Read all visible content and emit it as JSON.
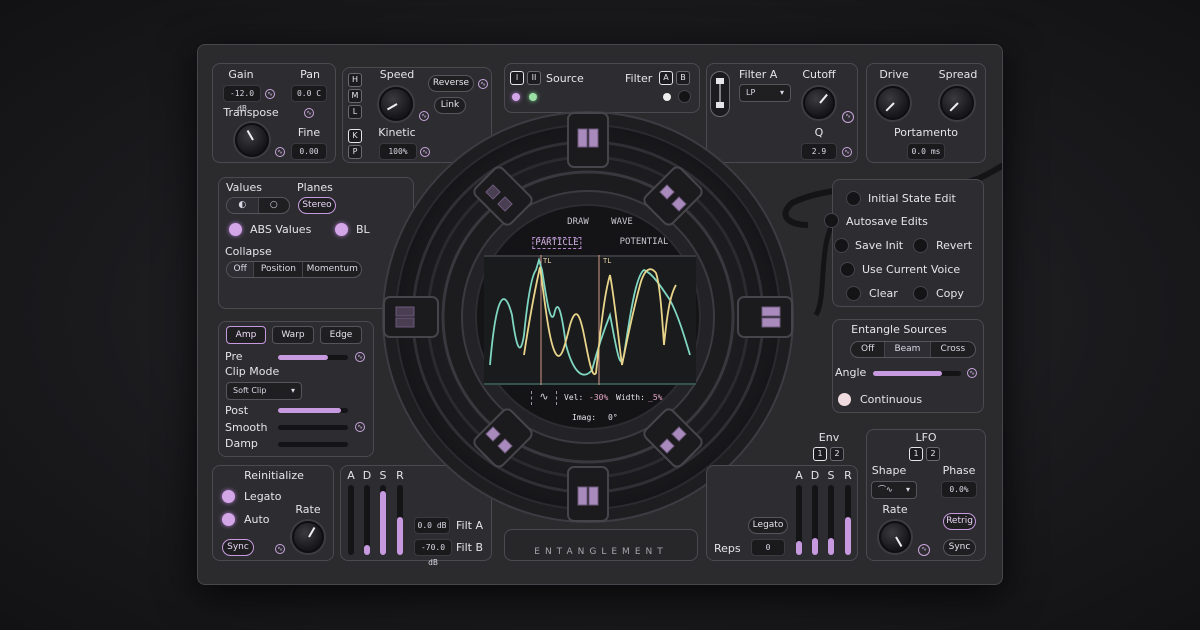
{
  "top_left": {
    "gain_label": "Gain",
    "gain_value": "-12.0 dB",
    "pan_label": "Pan",
    "pan_value": "0.0 C",
    "transpose_label": "Transpose",
    "fine_label": "Fine",
    "fine_value": "0.00"
  },
  "mode_buttons": [
    "H",
    "M",
    "L",
    "K",
    "P"
  ],
  "speed": {
    "label": "Speed",
    "kinetic_label": "Kinetic",
    "kinetic_value": "100%",
    "reverse_label": "Reverse",
    "link_label": "Link"
  },
  "source": {
    "roman": [
      "I",
      "II"
    ],
    "label": "Source",
    "filter_label": "Filter",
    "filter_options": [
      "A",
      "B"
    ]
  },
  "filter_a": {
    "label": "Filter A",
    "type_value": "LP",
    "cutoff_label": "Cutoff",
    "q_label": "Q",
    "q_value": "2.9"
  },
  "drive_spread": {
    "drive_label": "Drive",
    "spread_label": "Spread",
    "portamento_label": "Portamento",
    "portamento_value": "0.0 ms"
  },
  "values_panel": {
    "values_label": "Values",
    "planes_label": "Planes",
    "planes_value": "Stereo",
    "abs_label": "ABS Values",
    "bl_label": "BL",
    "collapse_label": "Collapse",
    "collapse_options": [
      "Off",
      "Position",
      "Momentum"
    ]
  },
  "amp_panel": {
    "tabs": [
      "Amp",
      "Warp",
      "Edge"
    ],
    "pre_label": "Pre",
    "pre_level": 0.72,
    "clip_mode_label": "Clip Mode",
    "clip_mode_value": "Soft Clip",
    "post_label": "Post",
    "post_level": 0.9,
    "smooth_label": "Smooth",
    "damp_label": "Damp"
  },
  "reinit": {
    "title": "Reinitialize",
    "legato_label": "Legato",
    "auto_label": "Auto",
    "sync_label": "Sync",
    "rate_label": "Rate"
  },
  "adsr_left": {
    "letters": [
      "A",
      "D",
      "S",
      "R"
    ],
    "levels": [
      0.0,
      0.15,
      0.92,
      0.55
    ],
    "filt_a_label": "Filt A",
    "filt_a_value": "0.0 dB",
    "filt_b_label": "Filt B",
    "filt_b_value": "-70.0 dB"
  },
  "brand": "ENTANGLEMENT",
  "display": {
    "tabs_top": [
      "DRAW",
      "WAVE"
    ],
    "tabs_bottom": [
      "PARTICLE",
      "POTENTIAL"
    ],
    "marker_label": "TL",
    "vel_label": "Vel:",
    "vel_value": "-30%",
    "width_label": "Width:",
    "width_value": "_5%",
    "imag_label": "Imag:",
    "imag_value": "0°"
  },
  "state_panel": {
    "initial_state": "Initial State Edit",
    "autosave": "Autosave Edits",
    "save_init": "Save Init",
    "revert": "Revert",
    "use_current": "Use Current Voice",
    "clear": "Clear",
    "copy": "Copy"
  },
  "entangle": {
    "title": "Entangle Sources",
    "options": [
      "Off",
      "Beam",
      "Cross"
    ],
    "angle_label": "Angle",
    "angle_level": 0.78,
    "continuous_label": "Continuous"
  },
  "env": {
    "label": "Env",
    "options": [
      "1",
      "2"
    ],
    "letters": [
      "A",
      "D",
      "S",
      "R"
    ],
    "levels": [
      0.2,
      0.25,
      0.25,
      0.55
    ],
    "legato_label": "Legato",
    "reps_label": "Reps",
    "reps_value": "0"
  },
  "lfo": {
    "label": "LFO",
    "options": [
      "1",
      "2"
    ],
    "shape_label": "Shape",
    "phase_label": "Phase",
    "phase_value": "0.0%",
    "rate_label": "Rate",
    "retrig_label": "Retrig",
    "sync_label": "Sync"
  },
  "colors": {
    "accent": "#c79adf",
    "panel": "#2b2b2e",
    "wave_teal": "#7fd6c2",
    "wave_yellow": "#e8d48a"
  }
}
